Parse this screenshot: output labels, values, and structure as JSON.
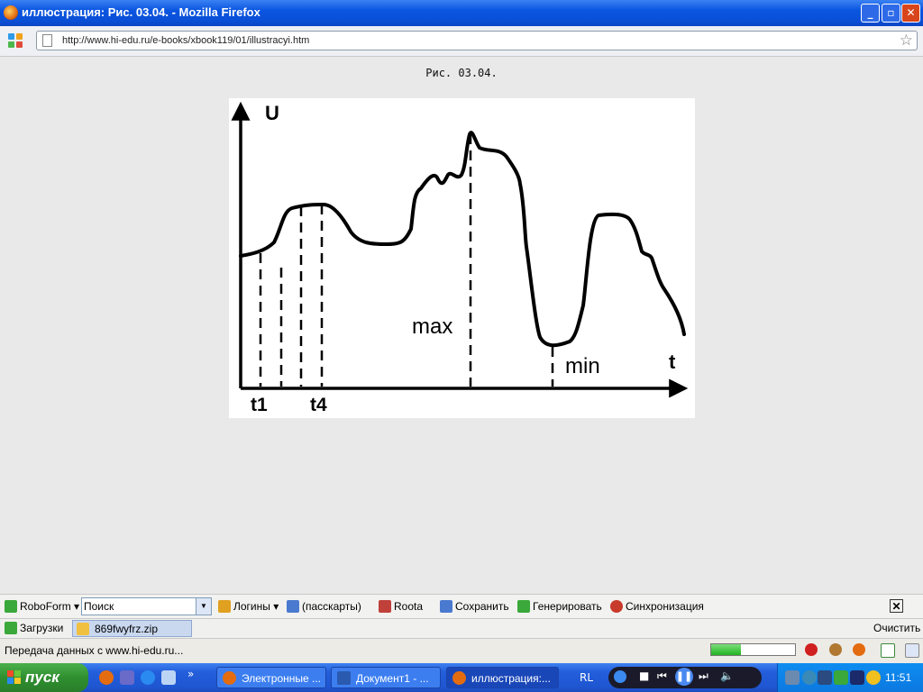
{
  "window": {
    "title": "иллюстрация: Рис. 03.04. - Mozilla Firefox",
    "controls": {
      "minimize": "_",
      "maximize": "▫",
      "close": "✕"
    }
  },
  "navbar": {
    "url": "http://www.hi-edu.ru/e-books/xbook119/01/illustracyi.htm",
    "bookmark_star": "☆"
  },
  "page": {
    "caption": "Рис. 03.04."
  },
  "chart_data": {
    "type": "line",
    "title": "",
    "xlabel": "t",
    "ylabel": "U",
    "tick_labels": [
      "t1",
      "t4"
    ],
    "annotations": [
      "max",
      "min"
    ],
    "series": [
      {
        "values": [
          0.38,
          0.42,
          0.6,
          0.62,
          0.48,
          0.5,
          0.7,
          0.72,
          0.9,
          0.8,
          0.72,
          0.05,
          0.65,
          0.55,
          0.3
        ]
      }
    ],
    "markers": [
      "t1",
      "t2",
      "t3",
      "t4",
      "max",
      "min"
    ]
  },
  "roboform": {
    "brand": "RoboForm",
    "search_placeholder": "Поиск",
    "search_value": "Поиск",
    "logins": "Логины",
    "passcards": "(пасскарты)",
    "roota": "Roota",
    "save": "Сохранить",
    "generate": "Генерировать",
    "sync": "Синхронизация",
    "close": "✕"
  },
  "downloads": {
    "label": "Загрузки",
    "file": "869fwyfrz.zip",
    "clear": "Очистить"
  },
  "status": {
    "text": "Передача данных с www.hi-edu.ru...",
    "progress": 0.35
  },
  "taskbar": {
    "start": "пуск",
    "more": "»",
    "tasks": [
      {
        "label": "Электронные ..."
      },
      {
        "label": "Документ1 - ..."
      },
      {
        "label": "иллюстрация:..."
      }
    ],
    "lang": "RL",
    "clock": "11:51"
  },
  "colors": {
    "titlebar": "#0a55e0",
    "taskbar": "#245edb",
    "start": "#2f8f2f",
    "progress": "#21b321"
  }
}
